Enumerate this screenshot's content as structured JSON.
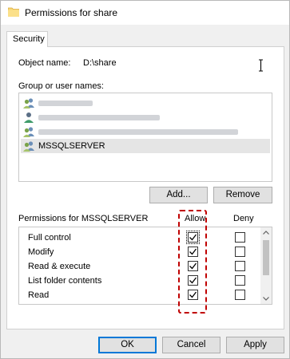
{
  "window": {
    "title": "Permissions for share"
  },
  "tabs": [
    {
      "label": "Security"
    }
  ],
  "object": {
    "label": "Object name:",
    "value": "D:\\share"
  },
  "groups": {
    "label": "Group or user names:",
    "users": [
      {
        "icon": "users-icon",
        "name": "",
        "selected": false
      },
      {
        "icon": "user-icon",
        "name": "",
        "selected": false
      },
      {
        "icon": "users-icon",
        "name": "",
        "selected": false
      },
      {
        "icon": "users-icon",
        "name": "MSSQLSERVER",
        "selected": true
      }
    ]
  },
  "buttons": {
    "add": "Add...",
    "remove": "Remove",
    "ok": "OK",
    "cancel": "Cancel",
    "apply": "Apply"
  },
  "permissions": {
    "label": "Permissions for MSSQLSERVER",
    "allow_header": "Allow",
    "deny_header": "Deny",
    "rows": [
      {
        "name": "Full control",
        "allow": true,
        "deny": false
      },
      {
        "name": "Modify",
        "allow": true,
        "deny": false
      },
      {
        "name": "Read & execute",
        "allow": true,
        "deny": false
      },
      {
        "name": "List folder contents",
        "allow": true,
        "deny": false
      },
      {
        "name": "Read",
        "allow": true,
        "deny": false
      }
    ]
  },
  "colors": {
    "highlight": "#c00000",
    "focus": "#0078d7"
  }
}
